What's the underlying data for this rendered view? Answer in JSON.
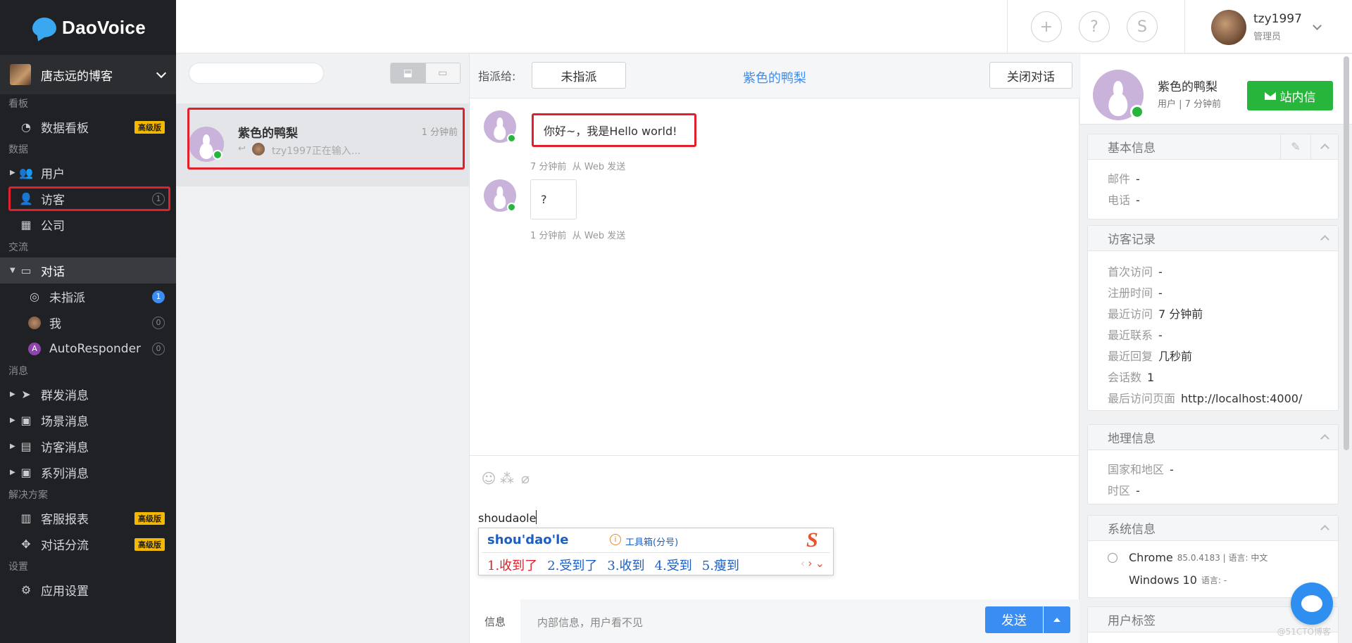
{
  "brand": {
    "name": "DaoVoice"
  },
  "workspace": {
    "name": "唐志远的博客"
  },
  "nav": {
    "section_board": "看板",
    "item_dashboard": "数据看板",
    "pro_badge": "高级版",
    "section_data": "数据",
    "item_users": "用户",
    "item_visitors": "访客",
    "visitors_count": "1",
    "item_company": "公司",
    "section_comm": "交流",
    "item_conversations": "对话",
    "item_unassigned": "未指派",
    "unassigned_count": "1",
    "item_me": "我",
    "me_count": "0",
    "item_autoresponder": "AutoResponder",
    "autoresponder_count": "0",
    "autoresponder_letter": "A",
    "section_messages": "消息",
    "item_broadcast": "群发消息",
    "item_scene": "场景消息",
    "item_visitor_msg": "访客消息",
    "item_series": "系列消息",
    "section_solutions": "解决方案",
    "item_reports": "客服报表",
    "item_routing": "对话分流",
    "section_settings": "设置",
    "item_app_settings": "应用设置"
  },
  "topbar": {
    "user_name": "tzy1997",
    "user_role": "管理员",
    "add_icon": "+",
    "help_icon": "?",
    "extra_icon": "S"
  },
  "conv_list": {
    "item": {
      "name": "紫色的鸭梨",
      "time": "1 分钟前",
      "preview": "tzy1997正在输入..."
    }
  },
  "chat": {
    "assign_label": "指派给:",
    "assign_value": "未指派",
    "title": "紫色的鸭梨",
    "close_label": "关闭对话",
    "messages": [
      {
        "text": "你好~，我是Hello world!",
        "time": "7 分钟前",
        "source": "从 Web 发送"
      },
      {
        "text": "?",
        "time": "1 分钟前",
        "source": "从 Web 发送"
      }
    ],
    "typed": "shoudaole",
    "ime": {
      "pinyin": "shou'dao'le",
      "toolbox": "工具箱(分号)",
      "candidates": [
        "1.收到了",
        "2.受到了",
        "3.收到",
        "4.受到",
        "5.瘦到"
      ]
    },
    "tab_info": "信息",
    "tab_internal": "内部信息，用户看不见",
    "send_label": "发送"
  },
  "info": {
    "name": "紫色的鸭梨",
    "subtitle": "用户 | 7 分钟前",
    "station_btn": "站内信",
    "basic": {
      "title": "基本信息",
      "email_k": "邮件",
      "email_v": "-",
      "phone_k": "电话",
      "phone_v": "-"
    },
    "visits": {
      "title": "访客记录",
      "first_k": "首次访问",
      "first_v": "-",
      "reg_k": "注册时间",
      "reg_v": "-",
      "last_k": "最近访问",
      "last_v": "7 分钟前",
      "contact_k": "最近联系",
      "contact_v": "-",
      "reply_k": "最近回复",
      "reply_v": "几秒前",
      "sessions_k": "会话数",
      "sessions_v": "1",
      "page_k": "最后访问页面",
      "page_v": "http://localhost:4000/"
    },
    "geo": {
      "title": "地理信息",
      "country_k": "国家和地区",
      "country_v": "-",
      "city_k": "时区",
      "city_v": "-"
    },
    "system": {
      "title": "系统信息",
      "browser": "Chrome",
      "browser_ver": "85.0.4183 | 语言: 中文",
      "os": "Windows 10",
      "os_lang": "语言: -"
    },
    "tags_title": "用户标签"
  },
  "watermark": "@51CTO博客"
}
